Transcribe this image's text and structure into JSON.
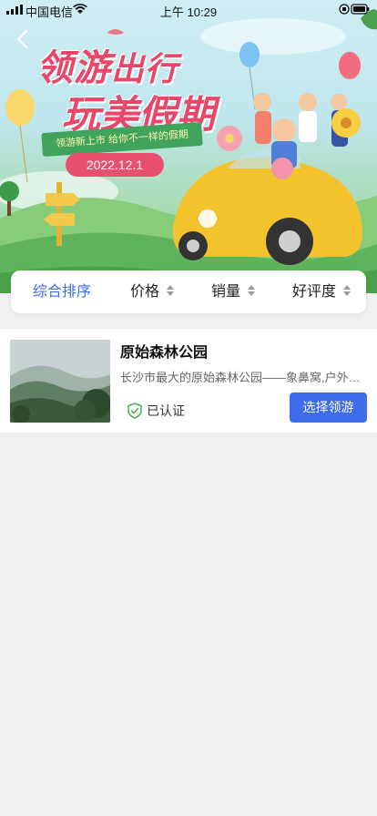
{
  "status_bar": {
    "carrier": "中国电信",
    "time": "上午 10:29"
  },
  "banner": {
    "title_line1_big": "领游",
    "title_line1_small": "出行",
    "title_line2": "玩美假期",
    "slogan": "领游新上市   给你不一样的假期",
    "date": "2022.12.1"
  },
  "sort_bar": {
    "items": [
      {
        "label": "综合排序",
        "active": true
      },
      {
        "label": "价格",
        "active": false
      },
      {
        "label": "销量",
        "active": false
      },
      {
        "label": "好评度",
        "active": false
      }
    ]
  },
  "list": {
    "items": [
      {
        "title": "原始森林公园",
        "description": "长沙市最大的原始森林公园——象鼻窝,户外徒步…",
        "badge": "已认证",
        "button_label": "选择领游",
        "thumbnail_icon": "forest-photo"
      }
    ]
  },
  "colors": {
    "accent": "#3d6bea",
    "banner_title": "#e8476a",
    "verified": "#4caf50",
    "page_bg": "#f0f0f0"
  }
}
